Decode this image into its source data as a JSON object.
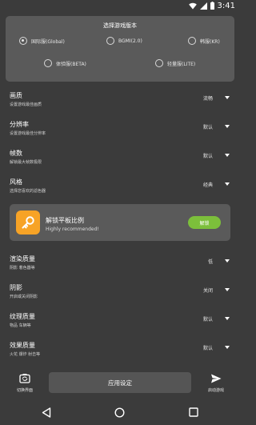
{
  "status_bar": {
    "time": "3:41",
    "icons": [
      "wifi-icon",
      "signal-icon",
      "battery-icon"
    ]
  },
  "version": {
    "title": "选择游戏版本",
    "options": [
      {
        "label": "国际服(Global)",
        "selected": true
      },
      {
        "label": "BGMI(2.0)",
        "selected": false
      },
      {
        "label": "韩服(KR)",
        "selected": false
      },
      {
        "label": "体验服(BETA)",
        "selected": false
      },
      {
        "label": "轻量服(LITE)",
        "selected": false
      }
    ]
  },
  "settings": {
    "quality": {
      "label": "画质",
      "sub": "设置游戏最佳画质",
      "value": "流畅"
    },
    "resolution": {
      "label": "分辨率",
      "sub": "设置游戏最佳分辨率",
      "value": "默认"
    },
    "fps": {
      "label": "帧数",
      "sub": "解锁最大帧数极限",
      "value": "默认"
    },
    "style": {
      "label": "风格",
      "sub": "选择您喜欢的滤色器",
      "value": "经典"
    }
  },
  "unlock": {
    "title": "解锁平板比例",
    "subtitle": "Highly recommended!",
    "button": "解锁"
  },
  "settings2": {
    "render": {
      "label": "渲染质量",
      "sub": "阴影 着色器等",
      "value": "低"
    },
    "shadow": {
      "label": "阴影",
      "sub": "开启或关闭阴影",
      "value": "关闭"
    },
    "texture": {
      "label": "纹理质量",
      "sub": "物品 车辆等",
      "value": "默认"
    },
    "effects": {
      "label": "效果质量",
      "sub": "火花 爆炸 射击等",
      "value": "默认"
    }
  },
  "bottom": {
    "left_label": "切换界面",
    "apply": "应用设定",
    "right_label": "启动游戏"
  },
  "colors": {
    "background": "#3b3b3b",
    "card": "#5a5a5a",
    "accent_green": "#7cbf3b",
    "icon_orange": "#f7a326"
  }
}
